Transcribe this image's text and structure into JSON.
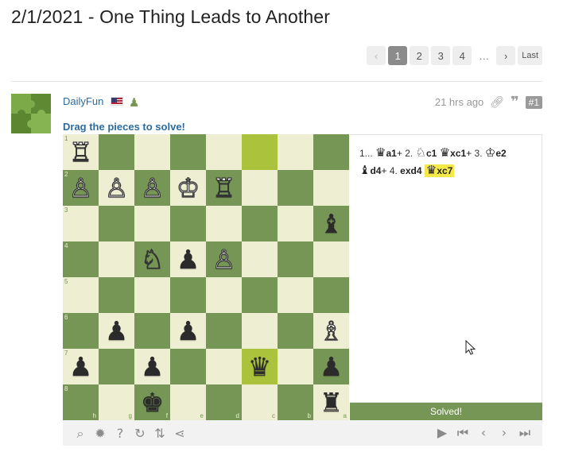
{
  "page": {
    "title": "2/1/2021 - One Thing Leads to Another"
  },
  "pagination": {
    "prev_icon": "chevron-left-icon",
    "pages": [
      "1",
      "2",
      "3",
      "4"
    ],
    "active_page": "1",
    "ellipsis": "…",
    "next_icon": "chevron-right-icon",
    "last_label": "Last"
  },
  "post": {
    "username": "DailyFun",
    "flag": "us-flag",
    "badge_icon": "pawn-icon",
    "time": "21 hrs ago",
    "post_number": "#1",
    "instruction": "Drag the pieces to solve!"
  },
  "board": {
    "orientation": "black",
    "ranks": [
      "1",
      "2",
      "3",
      "4",
      "5",
      "6",
      "7",
      "8"
    ],
    "files": [
      "h",
      "g",
      "f",
      "e",
      "d",
      "c",
      "b",
      "a"
    ],
    "rows": [
      [
        "♖",
        "",
        "",
        "",
        "",
        "",
        "",
        ""
      ],
      [
        "♙",
        "♙",
        "♙",
        "♔",
        "♖",
        "",
        "",
        ""
      ],
      [
        "",
        "",
        "",
        "",
        "",
        "",
        "",
        "♝"
      ],
      [
        "",
        "",
        "♘",
        "♟",
        "♙",
        "",
        "",
        ""
      ],
      [
        "",
        "",
        "",
        "",
        "",
        "",
        "",
        ""
      ],
      [
        "",
        "♟",
        "",
        "♟",
        "",
        "",
        "",
        "♗"
      ],
      [
        "♟",
        "",
        "♟",
        "",
        "",
        "♛",
        "",
        "♟"
      ],
      [
        "",
        "",
        "♚",
        "",
        "",
        "",
        "",
        "♜"
      ]
    ],
    "colors": [
      [
        "w",
        "",
        "",
        "",
        "",
        "",
        "",
        ""
      ],
      [
        "w",
        "w",
        "w",
        "w",
        "w",
        "",
        "",
        ""
      ],
      [
        "",
        "",
        "",
        "",
        "",
        "",
        "",
        "b"
      ],
      [
        "",
        "",
        "w",
        "b",
        "w",
        "",
        "",
        ""
      ],
      [
        "",
        "",
        "",
        "",
        "",
        "",
        "",
        ""
      ],
      [
        "",
        "b",
        "",
        "b",
        "",
        "",
        "",
        "w"
      ],
      [
        "b",
        "",
        "b",
        "",
        "",
        "b",
        "",
        "b"
      ],
      [
        "",
        "",
        "b",
        "",
        "",
        "",
        "",
        "b"
      ]
    ],
    "highlights": [
      [
        0,
        5
      ],
      [
        6,
        5
      ]
    ],
    "light_color": "#eeeed2",
    "dark_color": "#769656",
    "highlight_light": "#bbcb45",
    "highlight_dark": "#aac23c"
  },
  "moves": [
    {
      "num": "1...",
      "piece": "♛",
      "text": "a1",
      "suffix": "+"
    },
    {
      "num": "2.",
      "piece": "♘",
      "text": "c1",
      "suffix": ""
    },
    {
      "num": "",
      "piece": "♛",
      "text": "xc1",
      "suffix": "+"
    },
    {
      "num": "3.",
      "piece": "♔",
      "text": "e2",
      "suffix": ""
    },
    {
      "num": "",
      "piece": "♝",
      "text": "d4",
      "suffix": "+"
    },
    {
      "num": "4.",
      "piece": "",
      "text": "exd4",
      "suffix": ""
    },
    {
      "num": "",
      "piece": "♛",
      "text": "xc7",
      "suffix": "",
      "current": true
    }
  ],
  "status": {
    "solved_label": "Solved!"
  },
  "toolbar": {
    "left_icons": [
      "analysis-icon",
      "hint-icon",
      "help-icon",
      "retry-icon",
      "flip-icon",
      "share-icon"
    ],
    "right_icons": [
      "play-icon",
      "first-move-icon",
      "previous-move-icon",
      "next-move-icon",
      "last-move-icon"
    ]
  }
}
